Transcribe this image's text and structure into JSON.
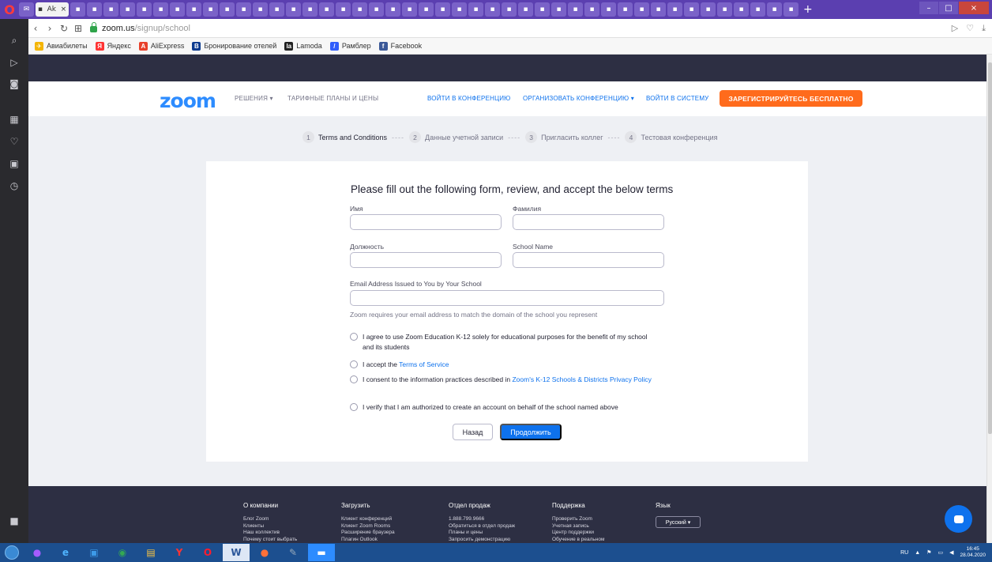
{
  "browser": {
    "url_host": "zoom.us",
    "url_path": "/signup/school",
    "tab_active_label": "Ak",
    "bookmarks": [
      {
        "label": "Авиабилеты",
        "color": "#f4b400",
        "glyph": "✈"
      },
      {
        "label": "Яндекс",
        "color": "#ff3333",
        "glyph": "Я"
      },
      {
        "label": "AliExpress",
        "color": "#e8402a",
        "glyph": "A"
      },
      {
        "label": "Бронирование отелей",
        "color": "#0c3b8f",
        "glyph": "B"
      },
      {
        "label": "Lamoda",
        "color": "#222222",
        "glyph": "la"
      },
      {
        "label": "Рамблер",
        "color": "#315efb",
        "glyph": "/"
      },
      {
        "label": "Facebook",
        "color": "#3b5998",
        "glyph": "f"
      }
    ]
  },
  "header": {
    "logo": "zoom",
    "nav_solutions": "РЕШЕНИЯ ▾",
    "nav_plans": "ТАРИФНЫЕ ПЛАНЫ И ЦЕНЫ",
    "nav_join": "ВОЙТИ В КОНФЕРЕНЦИЮ",
    "nav_host": "ОРГАНИЗОВАТЬ КОНФЕРЕНЦИЮ ▾",
    "nav_signin": "ВОЙТИ В СИСТЕМУ",
    "cta": "ЗАРЕГИСТРИРУЙТЕСЬ БЕСПЛАТНО"
  },
  "steps": [
    {
      "num": "1",
      "label": "Terms and Conditions"
    },
    {
      "num": "2",
      "label": "Данные учетной записи"
    },
    {
      "num": "3",
      "label": "Пригласить коллег"
    },
    {
      "num": "4",
      "label": "Тестовая конференция"
    }
  ],
  "step_separator": "----",
  "form": {
    "title": "Please fill out the following form, review, and accept the below terms",
    "first_name_label": "Имя",
    "last_name_label": "Фамилия",
    "position_label": "Должность",
    "school_label": "School Name",
    "email_label": "Email Address Issued to You by Your School",
    "first_name_value": "",
    "last_name_value": "",
    "position_value": "",
    "school_value": "",
    "email_value": "",
    "email_hint": "Zoom requires your email address to match the domain of the school you represent",
    "agree_k12": "I agree to use Zoom Education K-12 solely for educational purposes for the benefit of my school and its students",
    "accept_prefix": "I accept the ",
    "accept_link": "Terms of Service",
    "consent_prefix": "I consent to the information practices described in ",
    "consent_link": "Zoom's K-12 Schools & Districts Privacy Policy",
    "verify": "I verify that I am authorized to create an account on behalf of the school named above",
    "back_button": "Назад",
    "next_button": "Продолжить"
  },
  "footer": {
    "col1": {
      "head": "О компании",
      "items": [
        "Блог Zoom",
        "Клиенты",
        "Наш коллектив",
        "Почему стоит выбрать"
      ]
    },
    "col2": {
      "head": "Загрузить",
      "items": [
        "Клиент конференций",
        "Клиент Zoom Rooms",
        "Расширение браузера",
        "Плагин Outlook"
      ]
    },
    "col3": {
      "head": "Отдел продаж",
      "items": [
        "1.888.799.9666",
        "Обратиться в отдел продаж",
        "Планы и цены",
        "Запросить демонстрацию"
      ]
    },
    "col4": {
      "head": "Поддержка",
      "items": [
        "Проверить Zoom",
        "Учетная запись",
        "Центр поддержки",
        "Обучение в реальном"
      ]
    },
    "col5": {
      "head": "Язык",
      "select": "Русский ▾"
    }
  },
  "taskbar": {
    "lang": "RU",
    "time": "16:45",
    "date": "28.04.2020"
  }
}
